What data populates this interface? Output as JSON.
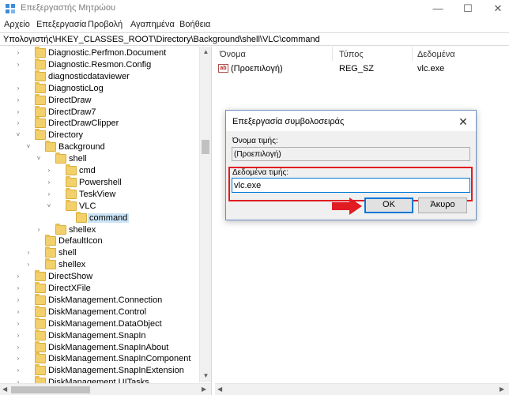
{
  "window": {
    "title": "Επεξεργαστής Μητρώου",
    "minimize": "—",
    "maximize": "☐",
    "close": "✕"
  },
  "menu": [
    "Αρχείο",
    "Επεξεργασία",
    "Προβολή",
    "Αγαπημένα",
    "Βοήθεια"
  ],
  "address": "Υπολογιστής\\HKEY_CLASSES_ROOT\\Directory\\Background\\shell\\VLC\\command",
  "tree": [
    {
      "label": "Diagnostic.Perfmon.Document",
      "chev": "›"
    },
    {
      "label": "Diagnostic.Resmon.Config",
      "chev": "›"
    },
    {
      "label": "diagnosticdataviewer",
      "chev": ""
    },
    {
      "label": "DiagnosticLog",
      "chev": "›"
    },
    {
      "label": "DirectDraw",
      "chev": "›"
    },
    {
      "label": "DirectDraw7",
      "chev": "›"
    },
    {
      "label": "DirectDrawClipper",
      "chev": "›"
    },
    {
      "label": "Directory",
      "chev": "˅"
    },
    {
      "label": "Background",
      "chev": "˅"
    },
    {
      "label": "shell",
      "chev": "˅"
    },
    {
      "label": "cmd",
      "chev": "›"
    },
    {
      "label": "Powershell",
      "chev": "›"
    },
    {
      "label": "TeskView",
      "chev": "›"
    },
    {
      "label": "VLC",
      "chev": "˅"
    },
    {
      "label": "command",
      "chev": ""
    },
    {
      "label": "shellex",
      "chev": "›"
    },
    {
      "label": "DefaultIcon",
      "chev": ""
    },
    {
      "label": "shell",
      "chev": "›"
    },
    {
      "label": "shellex",
      "chev": "›"
    },
    {
      "label": "DirectShow",
      "chev": "›"
    },
    {
      "label": "DirectXFile",
      "chev": "›"
    },
    {
      "label": "DiskManagement.Connection",
      "chev": "›"
    },
    {
      "label": "DiskManagement.Control",
      "chev": "›"
    },
    {
      "label": "DiskManagement.DataObject",
      "chev": "›"
    },
    {
      "label": "DiskManagement.SnapIn",
      "chev": "›"
    },
    {
      "label": "DiskManagement.SnapInAbout",
      "chev": "›"
    },
    {
      "label": "DiskManagement.SnapInComponent",
      "chev": "›"
    },
    {
      "label": "DiskManagement.SnapInExtension",
      "chev": "›"
    },
    {
      "label": "DiskManagement.UITasks",
      "chev": "›"
    }
  ],
  "list": {
    "headers": {
      "name": "Όνομα",
      "type": "Τύπος",
      "data": "Δεδομένα"
    },
    "rows": [
      {
        "icon": "ab",
        "name": "(Προεπιλογή)",
        "type": "REG_SZ",
        "data": "vlc.exe"
      }
    ]
  },
  "dialog": {
    "title": "Επεξεργασία συμβολοσειράς",
    "close": "✕",
    "name_label": "Όνομα τιμής:",
    "name_value": "(Προεπιλογή)",
    "data_label": "Δεδομένα τιμής:",
    "data_value": "vlc.exe",
    "ok": "OK",
    "cancel": "Άκυρο"
  },
  "colors": {
    "highlight": "#e01b22",
    "accent": "#0078d7",
    "folder": "#f2d06b",
    "selected": "#cce4f7"
  }
}
